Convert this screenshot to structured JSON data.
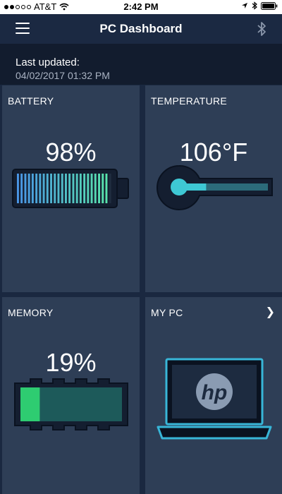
{
  "status_bar": {
    "carrier": "AT&T",
    "time": "2:42 PM",
    "signal_bars": 2
  },
  "navbar": {
    "title": "PC Dashboard",
    "menu_icon": "hamburger-menu-icon",
    "right_icon": "bluetooth-icon"
  },
  "updated": {
    "label": "Last updated:",
    "value": "04/02/2017 01:32 PM"
  },
  "tiles": {
    "battery": {
      "label": "BATTERY",
      "value": "98%",
      "level": 0.98
    },
    "temperature": {
      "label": "TEMPERATURE",
      "value": "106°F",
      "level": 0.27
    },
    "memory": {
      "label": "MEMORY",
      "value": "19%",
      "level": 0.19
    },
    "my_pc": {
      "label": "MY PC",
      "logo_text": "hp"
    }
  },
  "colors": {
    "background": "#1a2840",
    "tile": "#2e3e56",
    "battery_fill": "#4fd8c0",
    "temp_fill": "#3ec8d4",
    "memory_fill": "#2ecc71",
    "laptop_outline": "#38b6d8"
  }
}
